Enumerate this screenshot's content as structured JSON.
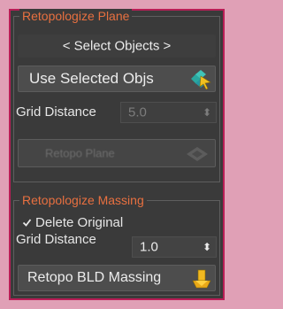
{
  "plane": {
    "title": "Retopologize Plane",
    "select_label": "< Select Objects >",
    "use_selected_label": "Use Selected Objs",
    "use_selected_icon": "selection-arrow-icon",
    "grid_label": "Grid Distance",
    "grid_value": "5.0",
    "relax_label": "Retopo Plane",
    "relax_icon": "plane-diamond-icon"
  },
  "massing": {
    "title": "Retopologize Massing",
    "delete_original_label": "Delete Original",
    "delete_original_checked": true,
    "grid_label": "Grid Distance",
    "grid_value": "1.0",
    "retopo_label": "Retopo BLD Massing",
    "retopo_icon": "building-massing-icon"
  },
  "colors": {
    "accent": "#e87040",
    "frame": "#b81e56",
    "panel_bg": "#3a3a3a"
  }
}
